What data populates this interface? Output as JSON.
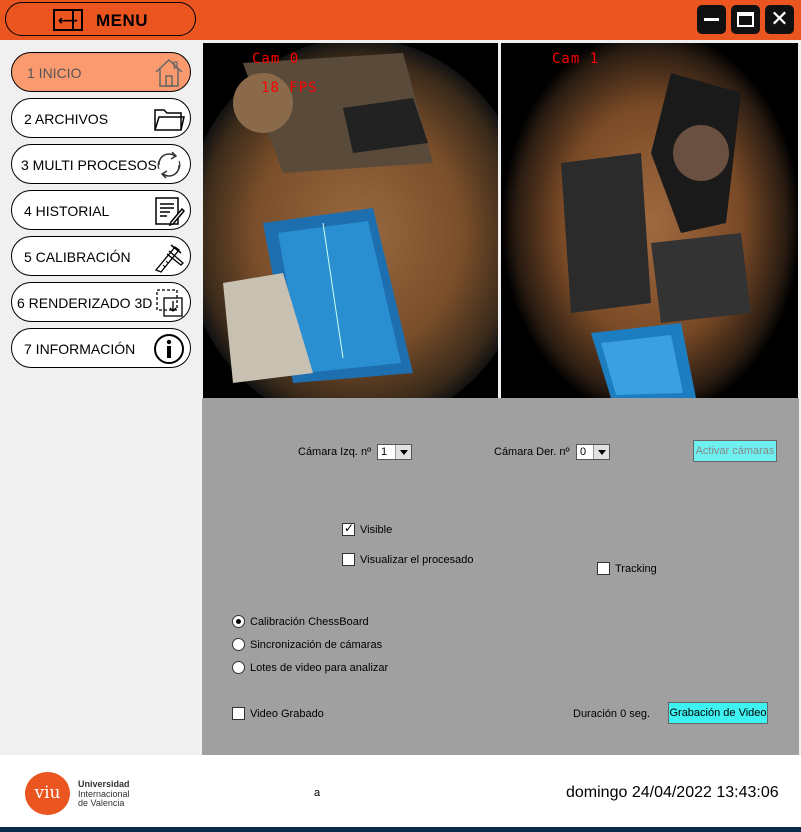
{
  "topbar": {
    "menu_label": "MENU",
    "accent": "#ea5520"
  },
  "sidebar": {
    "items": [
      {
        "label": "1 INICIO",
        "icon": "home-icon",
        "active": true
      },
      {
        "label": "2 ARCHIVOS",
        "icon": "folder-icon"
      },
      {
        "label": "3 MULTI PROCESOS",
        "icon": "refresh-icon"
      },
      {
        "label": "4 HISTORIAL",
        "icon": "document-edit-icon"
      },
      {
        "label": "5 CALIBRACIÓN",
        "icon": "caliper-icon"
      },
      {
        "label": "6 RENDERIZADO 3D",
        "icon": "render-box-icon"
      },
      {
        "label": "7 INFORMACIÓN",
        "icon": "info-icon"
      }
    ]
  },
  "cameras": {
    "left": {
      "label": "Cam 0",
      "fps": "18 FPS"
    },
    "right": {
      "label": "Cam 1"
    }
  },
  "controls": {
    "left_camera_label": "Cámara Izq. nº",
    "left_camera_value": "1",
    "right_camera_label": "Cámara Der. nº",
    "right_camera_value": "0",
    "activate_button": "Activar cámaras",
    "visible_label": "Visible",
    "visible_checked": true,
    "show_processing_label": "Visualizar el procesado",
    "tracking_label": "Tracking",
    "radio_options": [
      "Calibración ChessBoard",
      "Sincronización de cámaras",
      "Lotes de video para analizar"
    ],
    "radio_selected": 0,
    "recorded_video_label": "Video Grabado",
    "duration_label": "Duración 0 seg.",
    "record_button": "Grabación de Video",
    "button_color": "#3ef2f2"
  },
  "footer": {
    "logo_text": "viu",
    "university_line1": "Universidad",
    "university_line2": "Internacional",
    "university_line3": "de Valencia",
    "status_text": "a",
    "datetime": "domingo 24/04/2022 13:43:06"
  }
}
